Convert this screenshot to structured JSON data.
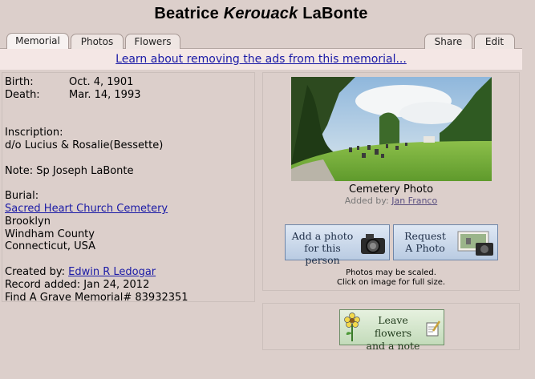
{
  "title": {
    "first": "Beatrice",
    "middle": "Kerouack",
    "last": "LaBonte"
  },
  "tabs": {
    "memorial": "Memorial",
    "photos": "Photos",
    "flowers": "Flowers",
    "share": "Share",
    "edit": "Edit"
  },
  "adbar": {
    "link": "Learn about removing the ads from this memorial..."
  },
  "memorial": {
    "birth_label": "Birth:",
    "birth_value": "Oct. 4, 1901",
    "death_label": "Death:",
    "death_value": "Mar. 14, 1993",
    "inscription_label": "Inscription:",
    "inscription_value": "d/o Lucius & Rosalie(Bessette)",
    "note": "Note: Sp Joseph LaBonte",
    "burial_label": "Burial:",
    "cemetery": "Sacred Heart Church Cemetery",
    "city": "Brooklyn",
    "county": "Windham County",
    "state_country": "Connecticut, USA",
    "created_label": "Created by:",
    "created_by": "Edwin R Ledogar",
    "record_added": "Record added: Jan 24, 2012",
    "memorial_id": "Find A Grave Memorial# 83932351"
  },
  "photo": {
    "caption": "Cemetery Photo",
    "added_label": "Added by:",
    "added_by": "Jan Franco",
    "add_btn_line1": "Add a photo",
    "add_btn_line2": "for this person",
    "req_btn_line1": "Request",
    "req_btn_line2": "A Photo",
    "scaled_line1": "Photos may be scaled.",
    "scaled_line2": "Click on image for full size."
  },
  "flowers": {
    "btn_line1": "Leave flowers",
    "btn_line2": "and a note"
  },
  "colors": {
    "page_bg": "#dccfcb",
    "link": "#1a1aa6",
    "ad_bar_bg": "#f4e7e5"
  },
  "icons": [
    "camera-icon",
    "flower-icon",
    "note-icon"
  ]
}
